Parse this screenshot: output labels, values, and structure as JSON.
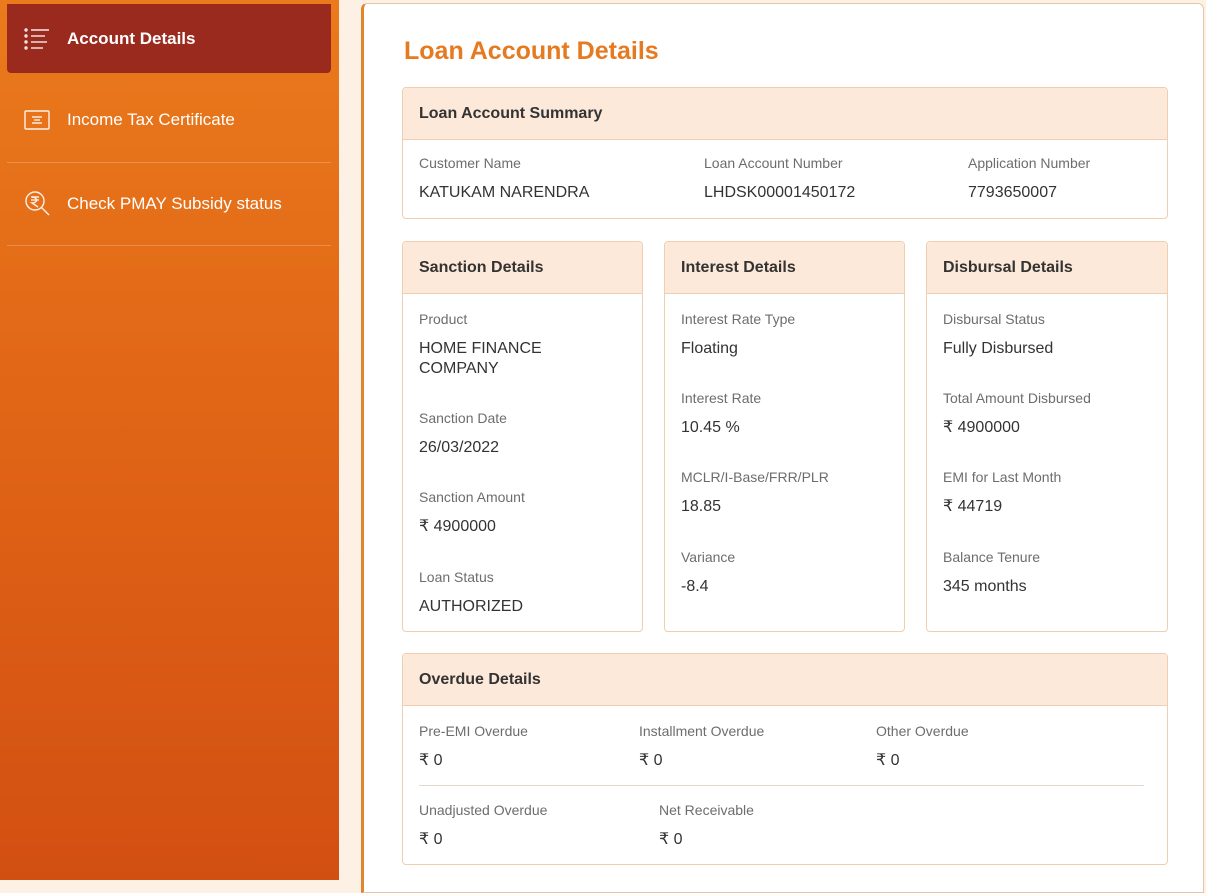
{
  "sidebar": {
    "items": [
      {
        "label": "Account Details",
        "icon": "list-icon",
        "active": true
      },
      {
        "label": "Income Tax Certificate",
        "icon": "certificate-icon"
      },
      {
        "label": "Check PMAY Subsidy status",
        "icon": "rupee-search-icon"
      }
    ]
  },
  "page": {
    "title": "Loan Account Details"
  },
  "summary": {
    "title": "Loan Account Summary",
    "customer_name_label": "Customer Name",
    "customer_name": "KATUKAM NARENDRA",
    "account_number_label": "Loan Account Number",
    "account_number": "LHDSK00001450172",
    "application_number_label": "Application Number",
    "application_number": "7793650007"
  },
  "sanction": {
    "title": "Sanction Details",
    "product_label": "Product",
    "product": "HOME FINANCE COMPANY",
    "date_label": "Sanction Date",
    "date": "26/03/2022",
    "amount_label": "Sanction Amount",
    "amount": "₹ 4900000",
    "status_label": "Loan Status",
    "status": "AUTHORIZED"
  },
  "interest": {
    "title": "Interest Details",
    "rate_type_label": "Interest Rate Type",
    "rate_type": "Floating",
    "rate_label": "Interest Rate",
    "rate": "10.45 %",
    "mclr_label": "MCLR/I-Base/FRR/PLR",
    "mclr": "18.85",
    "variance_label": "Variance",
    "variance": "-8.4"
  },
  "disbursal": {
    "title": "Disbursal Details",
    "status_label": "Disbursal Status",
    "status": "Fully Disbursed",
    "total_label": "Total Amount Disbursed",
    "total": "₹ 4900000",
    "emi_label": "EMI for Last Month",
    "emi": "₹ 44719",
    "tenure_label": "Balance Tenure",
    "tenure": "345 months"
  },
  "overdue": {
    "title": "Overdue Details",
    "pre_emi_label": "Pre-EMI Overdue",
    "pre_emi": "₹ 0",
    "installment_label": "Installment Overdue",
    "installment": "₹ 0",
    "other_label": "Other Overdue",
    "other": "₹ 0",
    "unadjusted_label": "Unadjusted Overdue",
    "unadjusted": "₹ 0",
    "net_receivable_label": "Net Receivable",
    "net_receivable": "₹ 0"
  }
}
